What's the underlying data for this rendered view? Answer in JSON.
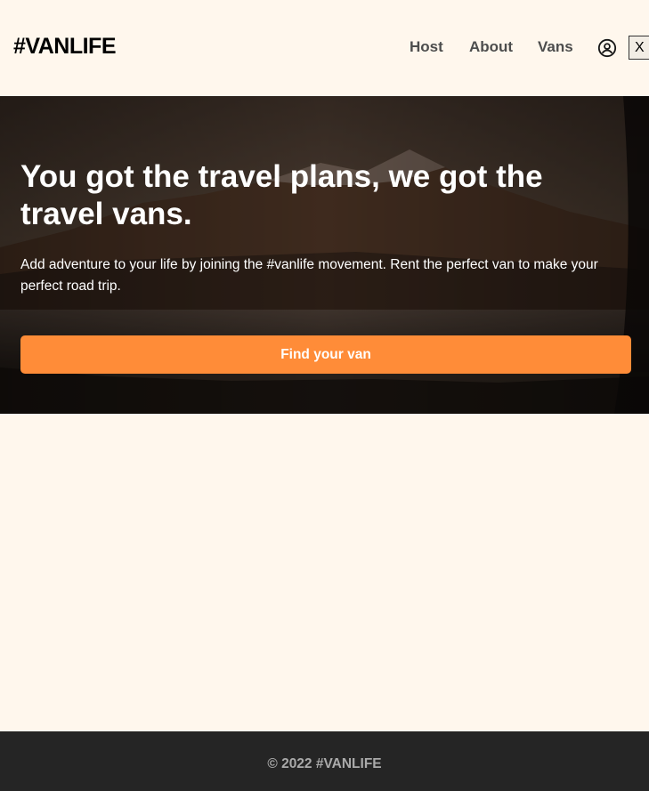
{
  "header": {
    "logo": "#VANLIFE",
    "nav": {
      "host": "Host",
      "about": "About",
      "vans": "Vans"
    },
    "user_icon": "user-circle-icon",
    "close_label": "X"
  },
  "hero": {
    "title": "You got the travel plans, we got the travel vans.",
    "text": "Add adventure to your life by joining the #vanlife movement. Rent the perfect van to make your perfect road trip.",
    "cta_label": "Find your van"
  },
  "footer": {
    "copyright": "© 2022 #VANLIFE"
  },
  "colors": {
    "background": "#FFF7ED",
    "accent": "#FF8C38",
    "footer_bg": "#252525",
    "footer_text": "#AAAAAA",
    "nav_text": "#4D4D4D"
  }
}
